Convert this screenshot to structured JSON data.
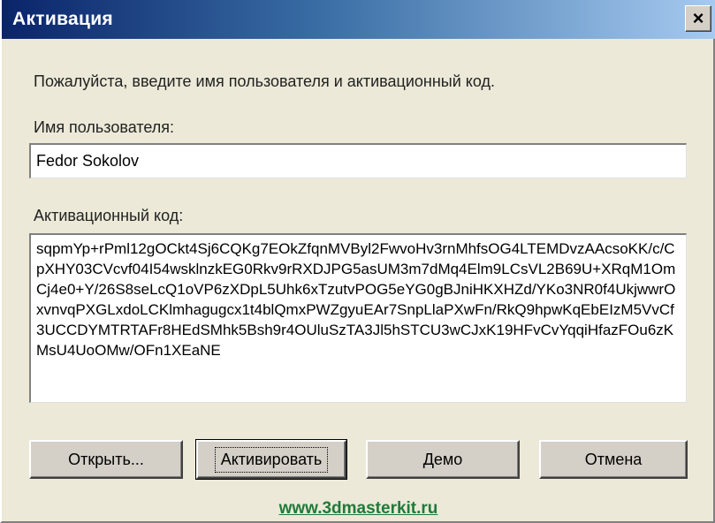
{
  "window": {
    "title": "Активация",
    "close_glyph": "×"
  },
  "instruction": "Пожалуйста, введите имя пользователя и активационный код.",
  "username": {
    "label": "Имя пользователя:",
    "value": "Fedor Sokolov"
  },
  "activation_code": {
    "label": "Активационный код:",
    "value": "sqpmYp+rPml12gOCkt4Sj6CQKg7EOkZfqnMVByl2FwvoHv3rnMhfsOG4LTEMDvzAAcsoKK/c/CpXHY03CVcvf04I54wsklnzkEG0Rkv9rRXDJPG5asUM3m7dMq4Elm9LCsVL2B69U+XRqM1OmCj4e0+Y/26S8seLcQ1oVP6zXDpL5Uhk6xTzutvPOG5eYG0gBJniHKXHZd/YKo3NR0f4UkjwwrOxvnvqPXGLxdoLCKlmhagugcx1t4blQmxPWZgyuEAr7SnpLlaPXwFn/RkQ9hpwKqEbEIzM5VvCf3UCCDYMTRTAFr8HEdSMhk5Bsh9r4OUluSzTA3Jl5hSTCU3wCJxK19HFvCvYqqiHfazFOu6zKMsU4UoOMw/OFn1XEaNE"
  },
  "buttons": {
    "open": "Открыть...",
    "activate": "Активировать",
    "demo": "Демо",
    "cancel": "Отмена"
  },
  "link": {
    "text": "www.3dmasterkit.ru"
  },
  "colors": {
    "titlebar_start": "#0a246a",
    "titlebar_end": "#a6caf0",
    "dialog_bg": "#ece9d8",
    "link": "#1f7a3a"
  }
}
